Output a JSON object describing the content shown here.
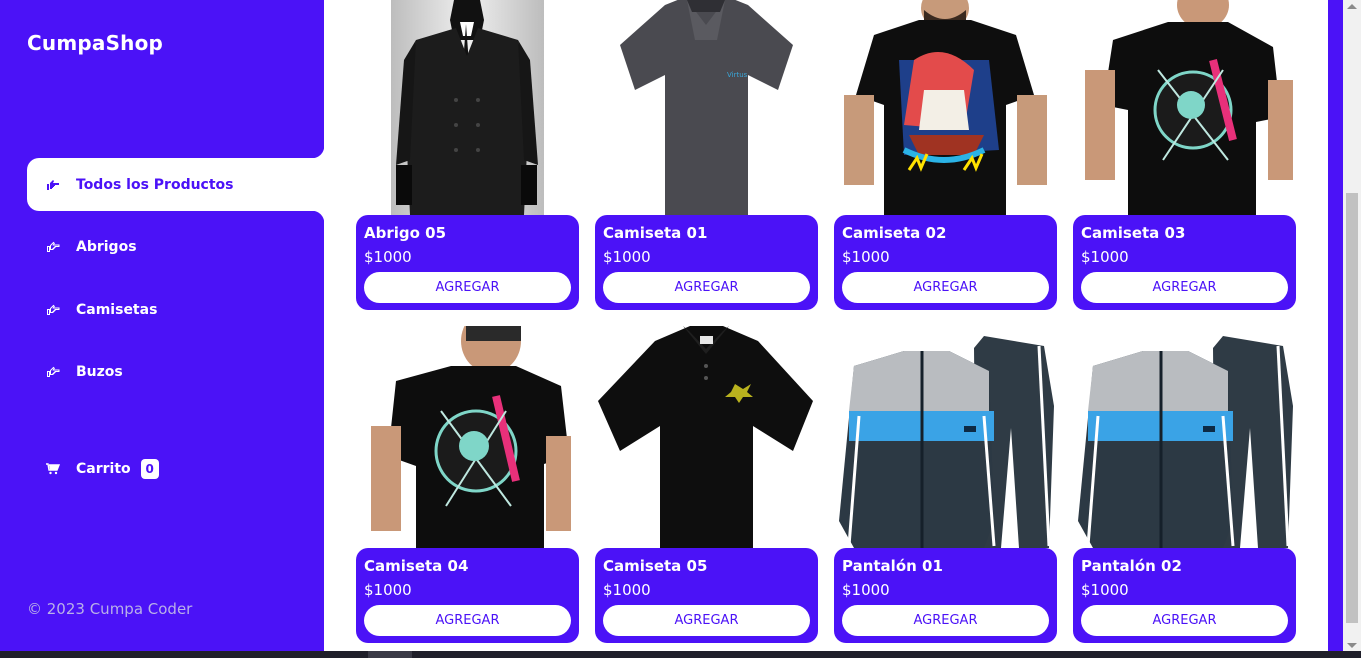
{
  "sidebar": {
    "logo": "CumpaShop",
    "items": [
      {
        "label": "Todos los Productos",
        "icon": "hand-point-right-icon"
      },
      {
        "label": "Abrigos",
        "icon": "hand-point-right-icon"
      },
      {
        "label": "Camisetas",
        "icon": "hand-point-right-icon"
      },
      {
        "label": "Buzos",
        "icon": "hand-point-right-icon"
      }
    ],
    "cart": {
      "label": "Carrito",
      "count": "0",
      "icon": "cart-icon"
    },
    "footer": "© 2023 Cumpa Coder"
  },
  "colors": {
    "brand": "#4b12f7",
    "white": "#ffffff"
  },
  "products": [
    {
      "title": "Abrigo 05",
      "price": "$1000",
      "button": "AGREGAR",
      "image": "black-coat"
    },
    {
      "title": "Camiseta 01",
      "price": "$1000",
      "button": "AGREGAR",
      "image": "grey-polo"
    },
    {
      "title": "Camiseta 02",
      "price": "$1000",
      "button": "AGREGAR",
      "image": "ship-print-tshirt"
    },
    {
      "title": "Camiseta 03",
      "price": "$1000",
      "button": "AGREGAR",
      "image": "astronaut-print-tshirt"
    },
    {
      "title": "Camiseta 04",
      "price": "$1000",
      "button": "AGREGAR",
      "image": "astronaut-print-tshirt"
    },
    {
      "title": "Camiseta 05",
      "price": "$1000",
      "button": "AGREGAR",
      "image": "black-polo"
    },
    {
      "title": "Pantalón 01",
      "price": "$1000",
      "button": "AGREGAR",
      "image": "tracksuit"
    },
    {
      "title": "Pantalón 02",
      "price": "$1000",
      "button": "AGREGAR",
      "image": "tracksuit"
    }
  ]
}
